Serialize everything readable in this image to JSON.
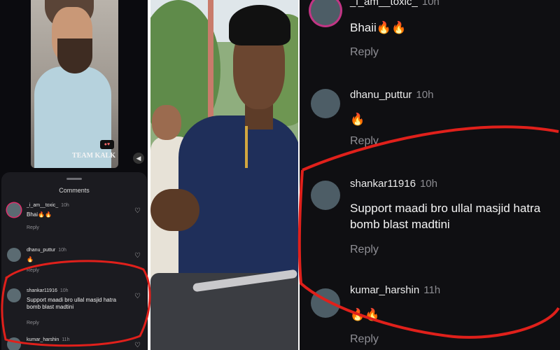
{
  "left": {
    "watermark": "TEAM KALK",
    "sheet_title": "Comments",
    "comments": [
      {
        "user": "_i_am__toxic_",
        "time": "10h",
        "text": "Bhai🔥🔥",
        "reply": "Reply"
      },
      {
        "user": "dhanu_puttur",
        "time": "10h",
        "text": "🔥",
        "reply": "Reply"
      },
      {
        "user": "shankar11916",
        "time": "10h",
        "text": "Support maadi bro ullal masjid hatra bomb blast madtini",
        "reply": "Reply"
      },
      {
        "user": "kumar_harshin",
        "time": "11h",
        "text": "",
        "reply": ""
      }
    ]
  },
  "right": {
    "comments": [
      {
        "user": "_i_am__toxic_",
        "time": "10h",
        "text": "Bhaii🔥🔥",
        "reply": "Reply"
      },
      {
        "user": "dhanu_puttur",
        "time": "10h",
        "text": "🔥",
        "reply": "Reply"
      },
      {
        "user": "shankar11916",
        "time": "10h",
        "text": "Support maadi bro ullal masjid hatra bomb blast madtini",
        "reply": "Reply"
      },
      {
        "user": "kumar_harshin",
        "time": "11h",
        "text": "🔥🔥",
        "reply": "Reply"
      }
    ]
  },
  "colors": {
    "annotation": "#e0201b",
    "story_ring": "#c13584",
    "sheet_bg": "#1b1b20"
  },
  "icons": {
    "heart": "heart-outline-icon",
    "volume": "volume-icon"
  }
}
